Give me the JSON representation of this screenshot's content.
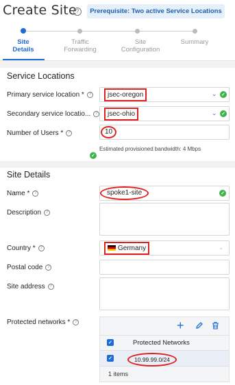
{
  "header": {
    "title": "Create Site",
    "help_icon": "help-question-icon",
    "prerequisite": "Prerequisite: Two active Service Locations"
  },
  "stepper": {
    "steps": [
      {
        "line1": "Site",
        "line2": "Details",
        "active": true
      },
      {
        "line1": "Traffic",
        "line2": "Forwarding",
        "active": false
      },
      {
        "line1": "Site",
        "line2": "Configuration",
        "active": false
      },
      {
        "line1": "Summary",
        "line2": "",
        "active": false
      }
    ]
  },
  "service_locations": {
    "title": "Service Locations",
    "primary_label": "Primary service location *",
    "primary_value": "jsec-oregon",
    "secondary_label": "Secondary service locatio...",
    "secondary_value": "jsec-ohio",
    "users_label": "Number of Users *",
    "users_value": "10",
    "bandwidth_hint": "Estimated provisioned bandwidth:  4 Mbps"
  },
  "site_details": {
    "title": "Site Details",
    "name_label": "Name *",
    "name_value": "spoke1-site",
    "description_label": "Description",
    "description_value": "",
    "country_label": "Country *",
    "country_value": "Germany",
    "postal_label": "Postal code",
    "postal_value": "",
    "address_label": "Site address",
    "address_value": "",
    "protected_label": "Protected networks *"
  },
  "protected_networks": {
    "column": "Protected Networks",
    "rows": [
      "10.99.99.0/24"
    ],
    "count": "1 items",
    "toolbar_icons": [
      "plus-icon",
      "edit-pencil-icon",
      "trash-icon"
    ]
  },
  "colors": {
    "accent": "#1f6bd6",
    "success": "#3cb44b",
    "highlight": "#e02020"
  }
}
